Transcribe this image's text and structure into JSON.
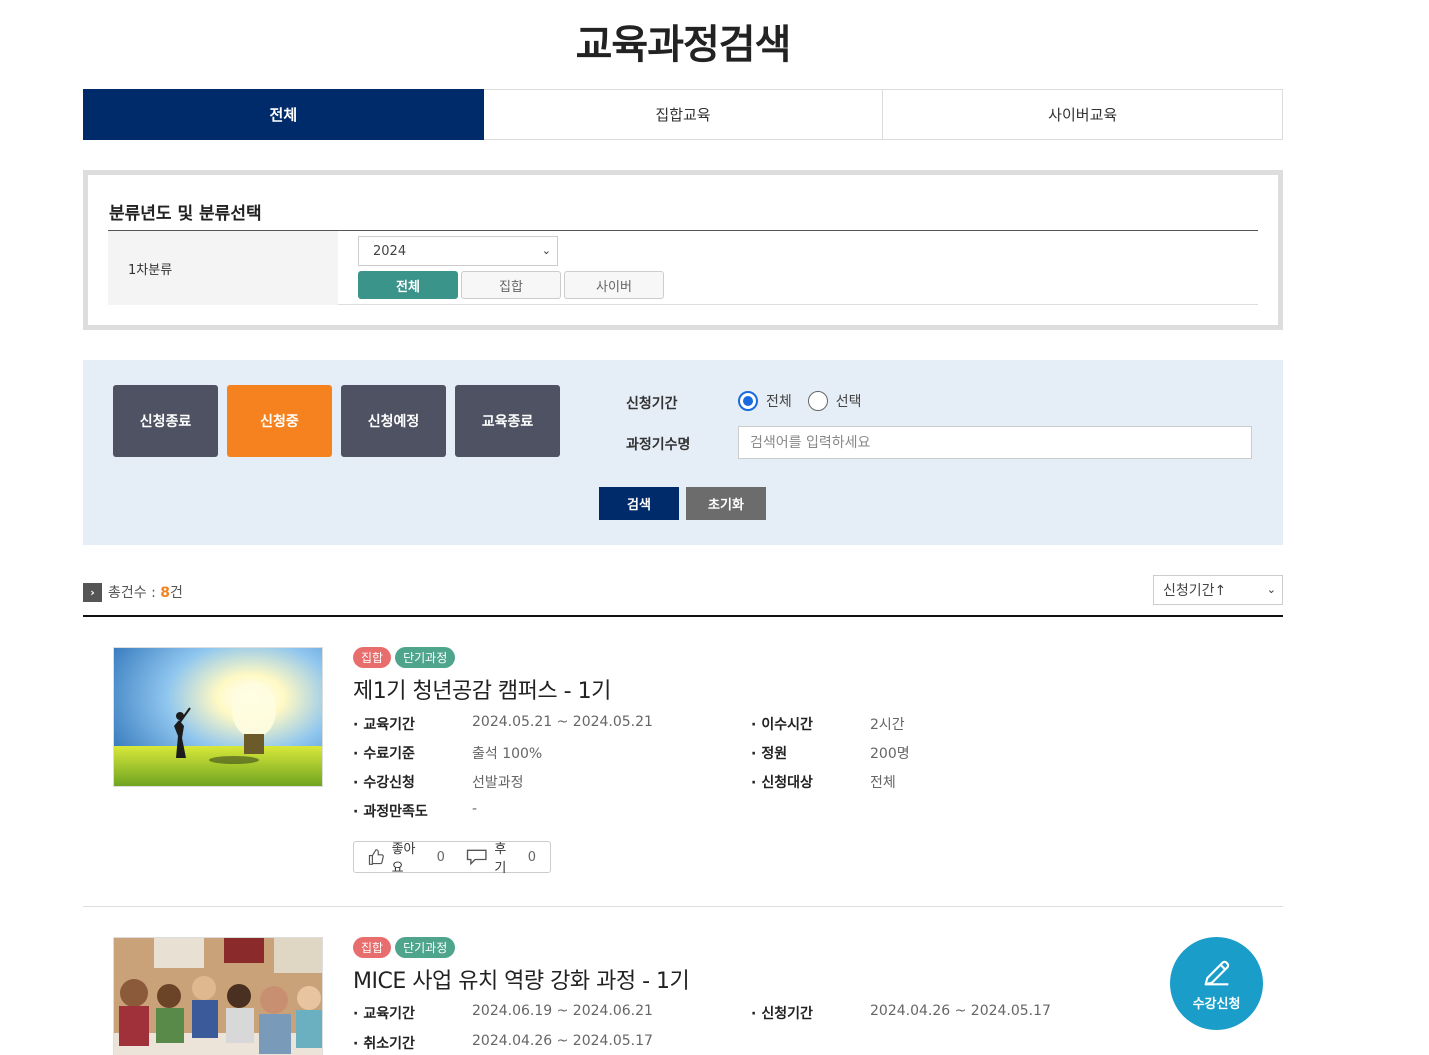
{
  "page": {
    "title": "교육과정검색"
  },
  "tabs": [
    {
      "label": "전체",
      "active": true
    },
    {
      "label": "집합교육",
      "active": false
    },
    {
      "label": "사이버교육",
      "active": false
    }
  ],
  "filter": {
    "title": "분류년도 및 분류선택",
    "row_label": "1차분류",
    "year_value": "2024",
    "categories": [
      {
        "label": "전체",
        "active": true
      },
      {
        "label": "집합",
        "active": false
      },
      {
        "label": "사이버",
        "active": false
      }
    ]
  },
  "status": {
    "buttons": [
      {
        "label": "신청종료",
        "active": false
      },
      {
        "label": "신청중",
        "active": true
      },
      {
        "label": "신청예정",
        "active": false
      },
      {
        "label": "교육종료",
        "active": false
      }
    ],
    "period_label": "신청기간",
    "period_options": [
      {
        "label": "전체",
        "checked": true
      },
      {
        "label": "선택",
        "checked": false
      }
    ],
    "keyword_label": "과정기수명",
    "keyword_placeholder": "검색어를 입력하세요",
    "search_label": "검색",
    "reset_label": "초기화"
  },
  "results": {
    "total_prefix": "총건수 : ",
    "total_count": "8",
    "total_suffix": "건",
    "sort_value": "신청기간↑"
  },
  "courses": [
    {
      "badges": [
        "집합",
        "단기과정"
      ],
      "title": "제1기 청년공감 캠퍼스 - 1기",
      "left_info": [
        {
          "key": "교육기간",
          "value": "2024.05.21 ~ 2024.05.21"
        },
        {
          "key": "수료기준",
          "value": "출석 100%"
        },
        {
          "key": "수강신청",
          "value": "선발과정"
        },
        {
          "key": "과정만족도",
          "value": "-"
        }
      ],
      "right_info": [
        {
          "key": "이수시간",
          "value": "2시간"
        },
        {
          "key": "정원",
          "value": "200명"
        },
        {
          "key": "신청대상",
          "value": "전체"
        }
      ],
      "like_label": "좋아요",
      "like_count": "0",
      "review_label": "후기",
      "review_count": "0"
    },
    {
      "badges": [
        "집합",
        "단기과정"
      ],
      "title": "MICE 사업 유치 역량 강화 과정 - 1기",
      "left_info": [
        {
          "key": "교육기간",
          "value": "2024.06.19 ~ 2024.06.21"
        },
        {
          "key": "취소기간",
          "value": "2024.04.26 ~ 2024.05.17"
        }
      ],
      "right_info": [
        {
          "key": "신청기간",
          "value": "2024.04.26 ~ 2024.05.17"
        }
      ],
      "apply_label": "수강신청"
    }
  ],
  "colors": {
    "navy": "#002b6b",
    "orange": "#f5821f",
    "teal": "#3a948a",
    "status_gray": "#4f5263",
    "apply_blue": "#1a9ec9"
  },
  "icons": [
    "chevron-down-icon",
    "arrow-right-icon",
    "thumbs-up-icon",
    "speech-bubble-icon",
    "pencil-icon"
  ]
}
